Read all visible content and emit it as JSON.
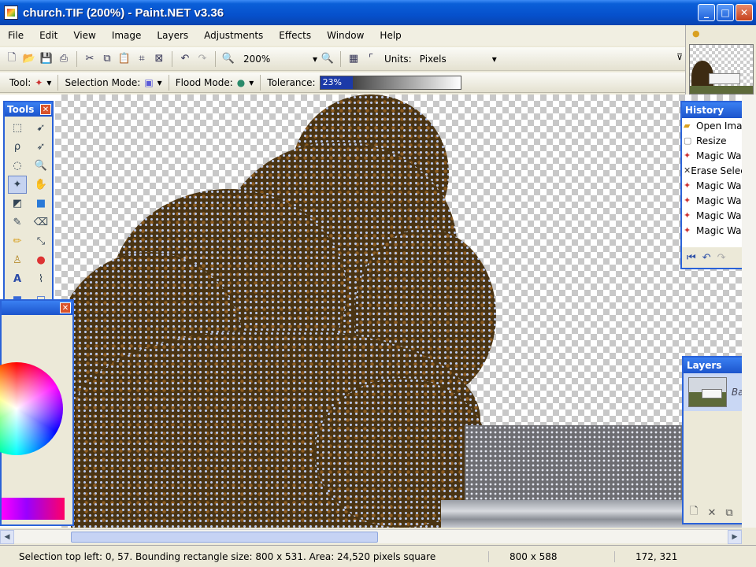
{
  "window": {
    "title": "church.TIF (200%) - Paint.NET v3.36",
    "minimize": "_",
    "maximize": "□",
    "close": "✕"
  },
  "menu": [
    "File",
    "Edit",
    "View",
    "Image",
    "Layers",
    "Adjustments",
    "Effects",
    "Window",
    "Help"
  ],
  "toolbar": {
    "zoom_value": "200%",
    "units_label": "Units:",
    "units_value": "Pixels"
  },
  "toolbar2": {
    "tool_label": "Tool:",
    "selection_mode_label": "Selection Mode:",
    "flood_mode_label": "Flood Mode:",
    "tolerance_label": "Tolerance:",
    "tolerance_value": "23%",
    "tolerance_fraction": 0.23
  },
  "tools_window": {
    "title": "Tools"
  },
  "history_window": {
    "title": "History",
    "items": [
      {
        "label": "Open Image",
        "icon": "folder-icon"
      },
      {
        "label": "Resize",
        "icon": "resize-icon"
      },
      {
        "label": "Magic Wand",
        "icon": "magic-wand-icon"
      },
      {
        "label": "Erase Selection",
        "icon": "erase-icon"
      },
      {
        "label": "Magic Wand",
        "icon": "magic-wand-icon"
      },
      {
        "label": "Magic Wand",
        "icon": "magic-wand-icon"
      },
      {
        "label": "Magic Wand",
        "icon": "magic-wand-icon"
      },
      {
        "label": "Magic Wand",
        "icon": "magic-wand-icon"
      }
    ]
  },
  "layers_window": {
    "title": "Layers",
    "layer_name": "Back"
  },
  "status": {
    "main": "Selection top left: 0, 57. Bounding rectangle size: 800 x 531. Area: 24,520 pixels square",
    "image_size": "800 x 588",
    "cursor_pos": "172, 321"
  },
  "colors": {
    "titlebar": "#0a5fd8",
    "panel_bg": "#ece9d8",
    "accent": "#2a62d8"
  }
}
